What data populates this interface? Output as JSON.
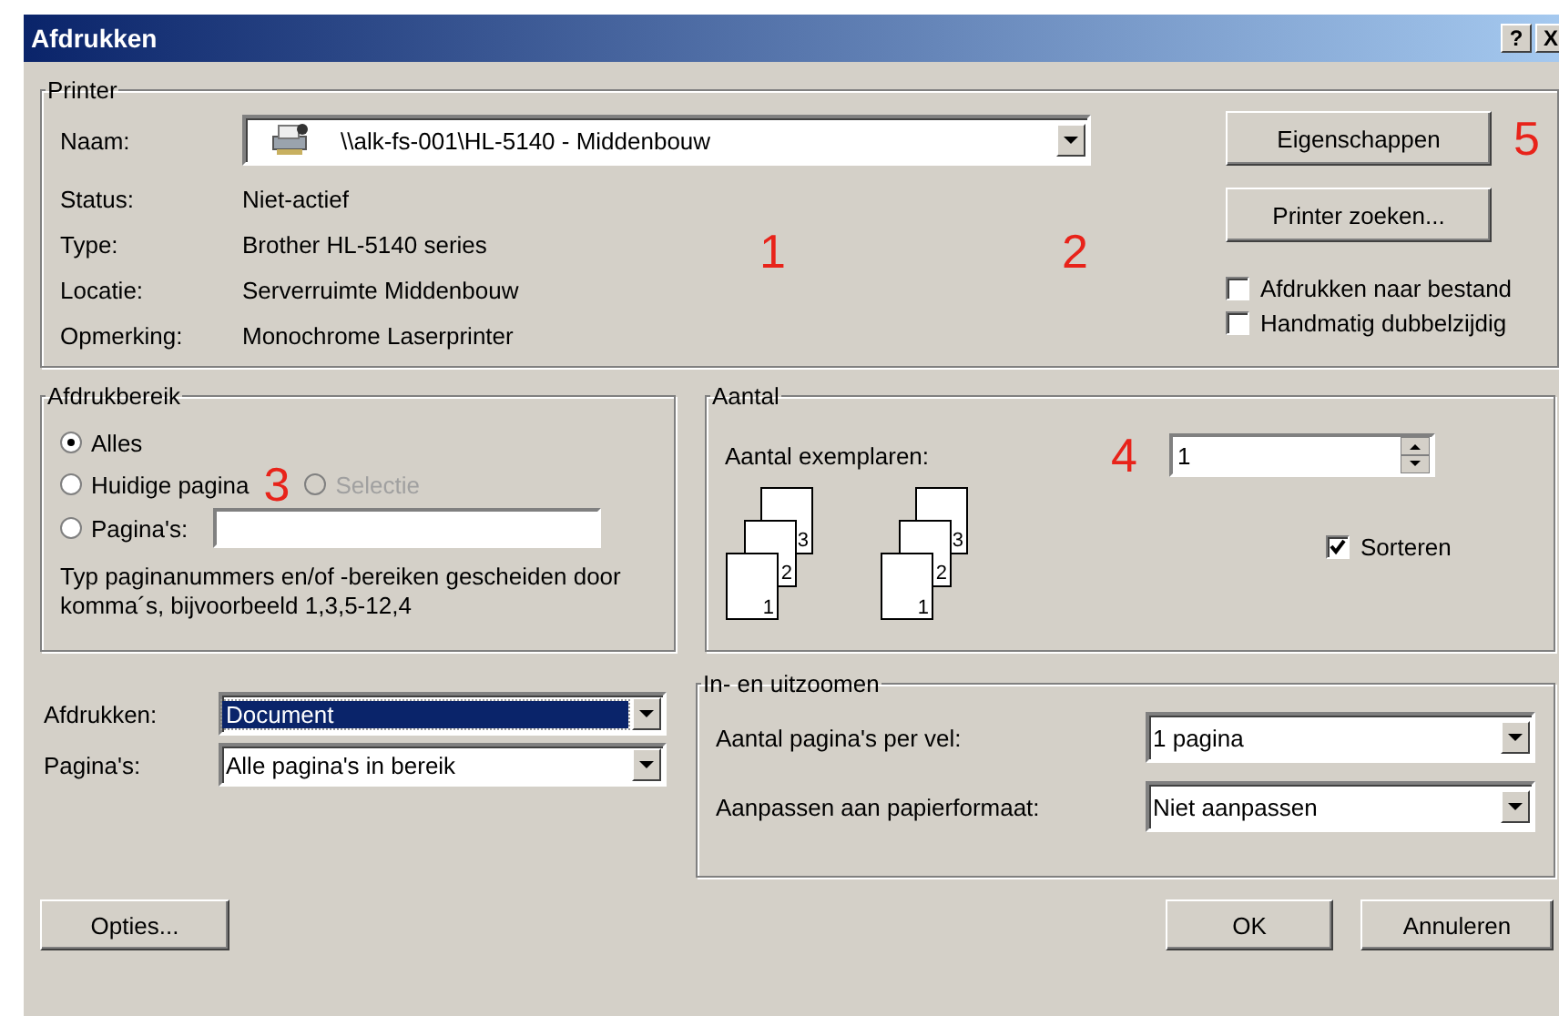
{
  "window": {
    "title": "Afdrukken",
    "help_button": "?",
    "close_button": "X"
  },
  "printer": {
    "legend": "Printer",
    "name_label": "Naam:",
    "name_value": "\\\\alk-fs-001\\HL-5140 - Middenbouw",
    "info": [
      {
        "label": "Status:",
        "value": "Niet-actief"
      },
      {
        "label": "Type:",
        "value": "Brother HL-5140 series"
      },
      {
        "label": "Locatie:",
        "value": "Serverruimte Middenbouw"
      },
      {
        "label": "Opmerking:",
        "value": "Monochrome Laserprinter"
      }
    ],
    "markers": [
      "1",
      "2"
    ],
    "properties_button": "Eigenschappen",
    "properties_marker": "5",
    "find_button": "Printer zoeken...",
    "options": [
      {
        "label": "Afdrukken naar bestand",
        "checked": false
      },
      {
        "label": "Handmatig dubbelzijdig",
        "checked": false
      }
    ]
  },
  "print_range": {
    "legend": "Afdrukbereik",
    "marker": "3",
    "options": [
      {
        "label": "Alles",
        "selected": true,
        "disabled": false
      },
      {
        "label": "Huidige pagina",
        "selected": false,
        "disabled": false
      },
      {
        "label": "Selectie",
        "selected": false,
        "disabled": true
      },
      {
        "label": "Pagina's:",
        "selected": false,
        "disabled": false
      }
    ],
    "hint": "Typ paginanummers en/of -bereiken gescheiden door komma´s, bijvoorbeeld 1,3,5-12,4"
  },
  "copies": {
    "legend": "Aantal",
    "label": "Aantal exemplaren:",
    "marker": "4",
    "value": "1",
    "stacks": [
      [
        "1",
        "2",
        "3"
      ],
      [
        "1",
        "2",
        "3"
      ]
    ],
    "collate": {
      "label": "Sorteren",
      "checked": true
    }
  },
  "print_what": [
    {
      "label": "Afdrukken:",
      "value": "Document",
      "focused": true
    },
    {
      "label": "Pagina's:",
      "value": "Alle pagina's in bereik",
      "focused": false
    }
  ],
  "zoom": {
    "legend": "In- en uitzoomen",
    "rows": [
      {
        "label": "Aantal pagina's per vel:",
        "value": "1 pagina"
      },
      {
        "label": "Aanpassen aan papierformaat:",
        "value": "Niet aanpassen"
      }
    ]
  },
  "buttons": {
    "options": "Opties...",
    "ok": "OK",
    "cancel": "Annuleren"
  }
}
